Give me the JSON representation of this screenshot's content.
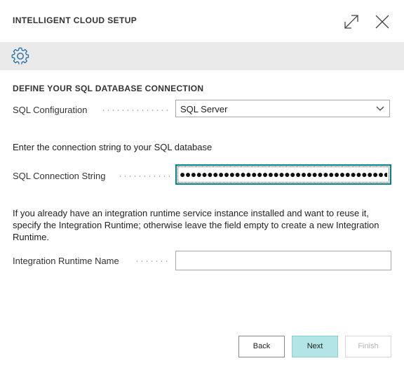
{
  "window": {
    "title": "INTELLIGENT CLOUD SETUP",
    "expand_icon": "expand-icon",
    "close_icon": "close-icon"
  },
  "actionbar": {
    "settings_icon": "gear-icon"
  },
  "section": {
    "title": "DEFINE YOUR SQL DATABASE CONNECTION"
  },
  "fields": {
    "sql_configuration": {
      "label": "SQL Configuration",
      "value": "SQL Server"
    },
    "connection_instructions": "Enter the connection string to your SQL database",
    "sql_connection_string": {
      "label": "SQL Connection String",
      "value": "●●●●●●●●●●●●●●●●●●●●●●●●●●●●●●●●●●●●●●●●"
    },
    "runtime_instructions": "If you already have an integration runtime service instance installed and want to reuse it, specify the Integration Runtime; otherwise leave the field empty to create a new Integration Runtime.",
    "integration_runtime_name": {
      "label": "Integration Runtime Name",
      "value": ""
    }
  },
  "buttons": {
    "back": "Back",
    "next": "Next",
    "finish": "Finish"
  },
  "colors": {
    "accent": "#008489",
    "next_button_bg": "#b3e5e7",
    "actionbar_bg": "#eaeaea",
    "gear_icon": "#1d6fa5"
  }
}
